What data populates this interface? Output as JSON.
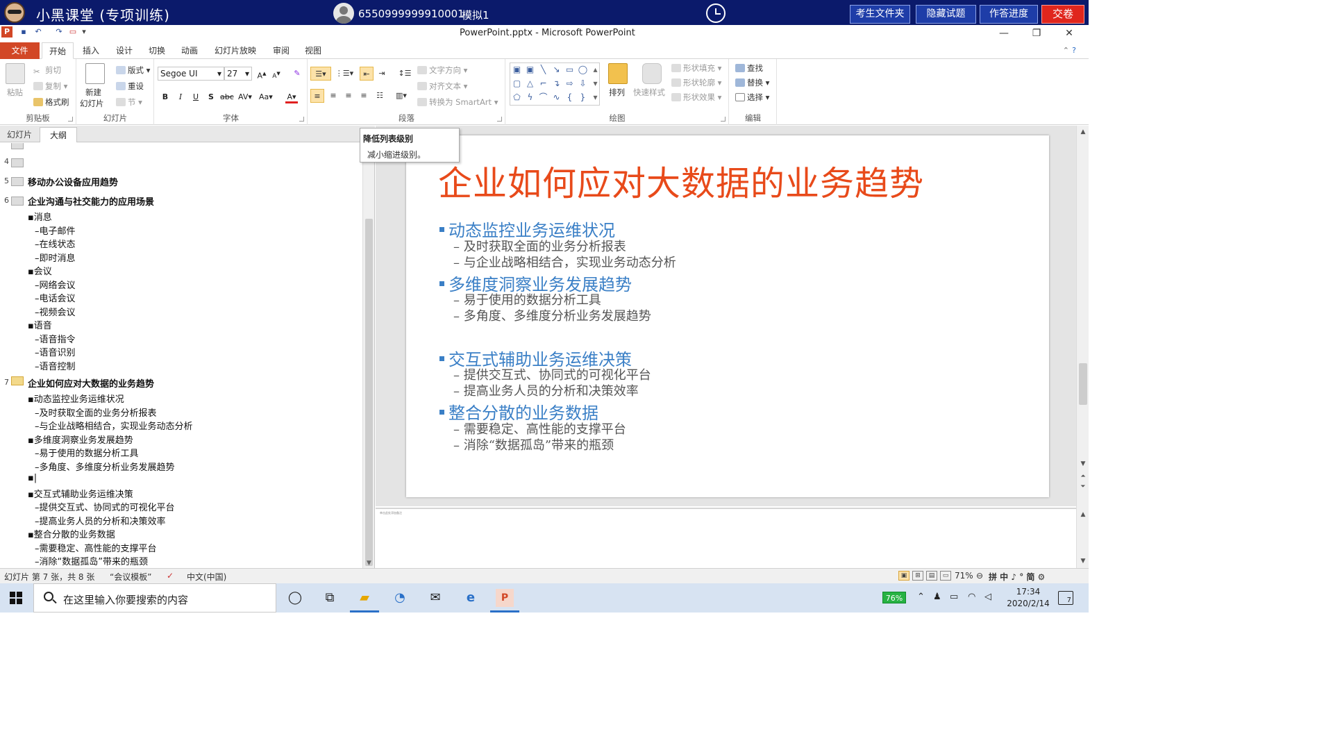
{
  "exam": {
    "title": "小黑课堂 (专项训练)",
    "user_id": "6550999999910001",
    "mode": "模拟1",
    "buttons": [
      "考生文件夹",
      "隐藏试题",
      "作答进度",
      "交卷"
    ]
  },
  "window": {
    "title": "PowerPoint.pptx - Microsoft PowerPoint"
  },
  "ribbon_tabs": [
    "文件",
    "开始",
    "插入",
    "设计",
    "切换",
    "动画",
    "幻灯片放映",
    "审阅",
    "视图"
  ],
  "ribbon": {
    "clipboard": {
      "paste": "粘贴",
      "cut": "剪切",
      "copy": "复制",
      "format_painter": "格式刷",
      "label": "剪贴板"
    },
    "slides": {
      "new_slide_1": "新建",
      "new_slide_2": "幻灯片",
      "layout": "版式",
      "reset": "重设",
      "section": "节",
      "label": "幻灯片"
    },
    "font": {
      "family": "Segoe UI",
      "size": "27",
      "label": "字体"
    },
    "paragraph": {
      "text_direction": "文字方向",
      "align_text": "对齐文本",
      "smartart": "转换为 SmartArt",
      "label": "段落"
    },
    "drawing": {
      "arrange": "排列",
      "quick_styles": "快速样式",
      "shape_fill": "形状填充",
      "shape_outline": "形状轮廓",
      "shape_effects": "形状效果",
      "label": "绘图"
    },
    "editing": {
      "find": "查找",
      "replace": "替换",
      "select": "选择",
      "label": "编辑"
    }
  },
  "tooltip": {
    "title": "降低列表级别",
    "desc": "减小缩进级别。"
  },
  "panel_tabs": [
    "幻灯片",
    "大纲"
  ],
  "outline": {
    "slide4_num": "4",
    "slide5": {
      "num": "5",
      "title": "移动办公设备应用趋势"
    },
    "slide6": {
      "num": "6",
      "title": "企业沟通与社交能力的应用场景",
      "items": [
        {
          "level": 1,
          "text": "▪消息"
        },
        {
          "level": 2,
          "text": "–电子邮件"
        },
        {
          "level": 2,
          "text": "–在线状态"
        },
        {
          "level": 2,
          "text": "–即时消息"
        },
        {
          "level": 1,
          "text": "▪会议"
        },
        {
          "level": 2,
          "text": "–网络会议"
        },
        {
          "level": 2,
          "text": "–电话会议"
        },
        {
          "level": 2,
          "text": "–视频会议"
        },
        {
          "level": 1,
          "text": "▪语音"
        },
        {
          "level": 2,
          "text": "–语音指令"
        },
        {
          "level": 2,
          "text": "–语音识别"
        },
        {
          "level": 2,
          "text": "–语音控制"
        }
      ]
    },
    "slide7": {
      "num": "7",
      "title": "企业如何应对大数据的业务趋势",
      "items": [
        {
          "level": 1,
          "text": "▪动态监控业务运维状况"
        },
        {
          "level": 2,
          "text": "–及时获取全面的业务分析报表"
        },
        {
          "level": 2,
          "text": "–与企业战略相结合，实现业务动态分析"
        },
        {
          "level": 1,
          "text": "▪多维度洞察业务发展趋势"
        },
        {
          "level": 2,
          "text": "–易于使用的数据分析工具"
        },
        {
          "level": 2,
          "text": "–多角度、多维度分析业务发展趋势"
        },
        {
          "level": 1,
          "text": "▪|"
        },
        {
          "level": 1,
          "text": "▪交互式辅助业务运维决策"
        },
        {
          "level": 2,
          "text": "–提供交互式、协同式的可视化平台"
        },
        {
          "level": 2,
          "text": "–提高业务人员的分析和决策效率"
        },
        {
          "level": 1,
          "text": "▪整合分散的业务数据"
        },
        {
          "level": 2,
          "text": "–需要稳定、高性能的支撑平台"
        },
        {
          "level": 2,
          "text": "–消除“数据孤岛”带来的瓶颈"
        }
      ]
    }
  },
  "slide": {
    "title": "企业如何应对大数据的业务趋势",
    "lines": [
      {
        "level": 1,
        "text": "动态监控业务运维状况"
      },
      {
        "level": 2,
        "text": "– 及时获取全面的业务分析报表"
      },
      {
        "level": 2,
        "text": "– 与企业战略相结合，实现业务动态分析"
      },
      {
        "level": 1,
        "text": "多维度洞察业务发展趋势"
      },
      {
        "level": 2,
        "text": "– 易于使用的数据分析工具"
      },
      {
        "level": 2,
        "text": "– 多角度、多维度分析业务发展趋势"
      },
      {
        "level": 1,
        "text": "交互式辅助业务运维决策"
      },
      {
        "level": 2,
        "text": "– 提供交互式、协同式的可视化平台"
      },
      {
        "level": 2,
        "text": "– 提高业务人员的分析和决策效率"
      },
      {
        "level": 1,
        "text": "整合分散的业务数据"
      },
      {
        "level": 2,
        "text": "– 需要稳定、高性能的支撑平台"
      },
      {
        "level": 2,
        "text": "– 消除“数据孤岛”带来的瓶颈"
      }
    ]
  },
  "notes": {
    "text": "单击此处添加备注"
  },
  "status": {
    "slide_info": "幻灯片 第 7 张，共 8 张",
    "template": "“会议模板”",
    "language": "中文(中国)",
    "zoom": "71%",
    "ime": "拼 中 ♪ ° 简 ⚙"
  },
  "taskbar": {
    "search_placeholder": "在这里输入你要搜索的内容",
    "battery": "76%",
    "time": "17:34",
    "date": "2020/2/14",
    "notification_count": "7"
  },
  "colors": {
    "exam_bar": "#0b1a6b",
    "submit": "#e0261d",
    "slide_title": "#e84a1a",
    "slide_bullet": "#3a7fc6",
    "file_tab": "#d24726"
  }
}
